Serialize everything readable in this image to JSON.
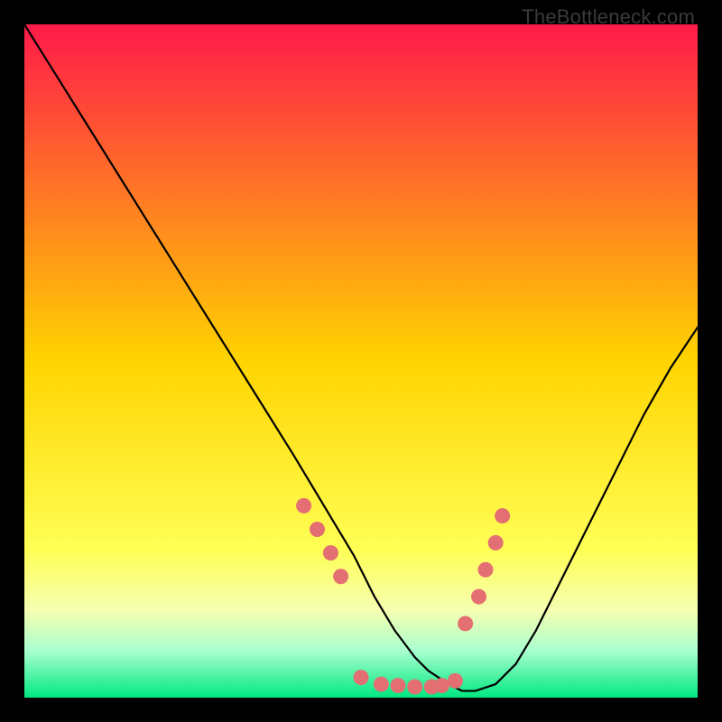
{
  "watermark": "TheBottleneck.com",
  "chart_data": {
    "type": "line",
    "title": "",
    "xlabel": "",
    "ylabel": "",
    "xlim": [
      0,
      100
    ],
    "ylim": [
      0,
      100
    ],
    "background_gradient": {
      "stops": [
        {
          "offset": 0,
          "color": "#ff1a4a"
        },
        {
          "offset": 50,
          "color": "#ffd400"
        },
        {
          "offset": 78,
          "color": "#ffff55"
        },
        {
          "offset": 87,
          "color": "#f6ffb0"
        },
        {
          "offset": 93,
          "color": "#aaffd0"
        },
        {
          "offset": 100,
          "color": "#00e880"
        }
      ]
    },
    "series": [
      {
        "name": "curve",
        "x": [
          0,
          5,
          10,
          15,
          20,
          25,
          30,
          35,
          40,
          43,
          46,
          49,
          52,
          55,
          58,
          60,
          63,
          65,
          67,
          70,
          73,
          76,
          80,
          84,
          88,
          92,
          96,
          100
        ],
        "y": [
          100,
          92,
          84,
          76,
          68,
          60,
          52,
          44,
          36,
          31,
          26,
          21,
          15,
          10,
          6,
          4,
          2,
          1,
          1,
          2,
          5,
          10,
          18,
          26,
          34,
          42,
          49,
          55
        ]
      }
    ],
    "markers": {
      "name": "dots",
      "color": "#e46f73",
      "x": [
        41.5,
        43.5,
        45.5,
        47.0,
        50.0,
        53.0,
        55.5,
        58.0,
        60.5,
        62.0,
        64.0,
        65.5,
        67.5,
        68.5,
        70.0,
        71.0
      ],
      "y": [
        28.5,
        25.0,
        21.5,
        18.0,
        3.0,
        2.0,
        1.8,
        1.6,
        1.6,
        1.8,
        2.5,
        11.0,
        15.0,
        19.0,
        23.0,
        27.0
      ]
    }
  }
}
